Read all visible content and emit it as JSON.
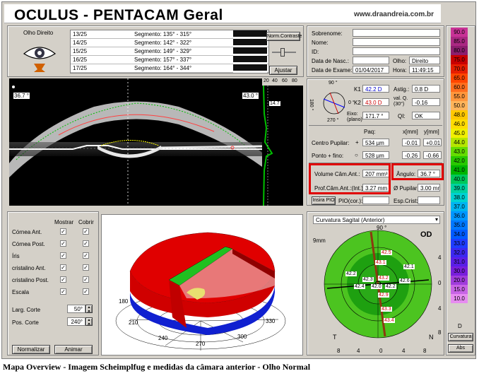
{
  "header": {
    "title": "OCULUS  -  PENTACAM   Geral",
    "site": "www.draandreia.com.br"
  },
  "eye_panel": {
    "label": "Olho Direito"
  },
  "segments": [
    {
      "index": "13/25",
      "text": "Segmento: 135° - 315°"
    },
    {
      "index": "14/25",
      "text": "Segmento: 142° - 322°"
    },
    {
      "index": "15/25",
      "text": "Segmento: 149° - 329°"
    },
    {
      "index": "16/25",
      "text": "Segmento: 157° - 337°"
    },
    {
      "index": "17/25",
      "text": "Segmento: 164° - 344°"
    }
  ],
  "buttons": {
    "norm_contrast": "Norm.Contraste",
    "adjust": "Ajustar",
    "normalize": "Normalizar",
    "animate": "Animar",
    "insira_pio": "Insira PIO",
    "curvatura": "Curvatura",
    "abs": "Abs"
  },
  "scheimpflug": {
    "left_angle": "36.7 °",
    "right_angle": "43.0 °",
    "histo_labels": [
      "20",
      "40",
      "60",
      "80"
    ],
    "histo_value": "14.7"
  },
  "patient": {
    "labels": {
      "surname": "Sobrenome:",
      "name": "Nome:",
      "id": "ID:",
      "birth": "Data de Nasc.:",
      "eye": "Olho:",
      "exam_date": "Data de Exame:",
      "time": "Hora:"
    },
    "surname": "",
    "name": "",
    "id": "",
    "birth": "",
    "eye": "Direito",
    "exam_date": "01/04/2017",
    "time": "11:49:15"
  },
  "keratometry": {
    "k1_label": "K1",
    "k1": "42.2 D",
    "k2_label": "K2",
    "k2": "43.0 D",
    "astig_label": "Astig.:",
    "astig": "0.8 D",
    "q_label": "val. Q.\n(30°)",
    "q": "-0.16",
    "axis_label": "Eixo:\n(plano)",
    "axis": "171.7 °",
    "qi_label": "QI:",
    "qi": "OK",
    "compass": {
      "top": "90 °",
      "left": "180 °",
      "bottom": "270 °",
      "right": "0 °"
    }
  },
  "pupil": {
    "hdr_paq": "Paq:",
    "hdr_x": "x[mm]",
    "hdr_y": "y[mm]",
    "centro_label": "Centro Pupilar:",
    "centro_sym": "+",
    "centro_paq": "534 µm",
    "centro_x": "-0.01",
    "centro_y": "+0.01",
    "ponto_label": "Ponto + fino:",
    "ponto_sym": "○",
    "ponto_paq": "528 µm",
    "ponto_x": "-0.26",
    "ponto_y": "-0.66"
  },
  "chamber": {
    "vol_label": "Volume Câm.Ant.:",
    "vol": "207 mm³",
    "angle_label": "Ângulo:",
    "angle": "36.7 °",
    "depth_label": "Prof.Câm.Ant.:(Int.)",
    "depth": "3.27 mm",
    "pupil_label": "Ø Pupilar:",
    "pupil": "3.00 mm",
    "pio_cor": "PIO(cor.):",
    "esp_crist": "Esp.Crist:"
  },
  "layers": {
    "hdr_show": "Mostrar",
    "hdr_cut": "Cobrir",
    "rows": [
      "Córnea Ant.",
      "Córnea Post.",
      "Íris",
      "cristalino Ant.",
      "cristalino Post.",
      "Escala"
    ],
    "cut_width_label": "Larg. Corte",
    "cut_width": "50°",
    "cut_pos_label": "Pos. Corte",
    "cut_pos": "240°"
  },
  "view3d": {
    "a180": "180",
    "a210": "210",
    "a240": "240",
    "a270": "270",
    "a300": "300",
    "a330": "330"
  },
  "map": {
    "dropdown": "Curvatura Sagital (Anterior)",
    "od": "OD",
    "mm": "9mm",
    "top90": "90 °",
    "t": "T",
    "n": "N",
    "ticks": [
      "8",
      "4",
      "0",
      "4",
      "8"
    ],
    "rticks": [
      "4",
      "0",
      "4",
      "8"
    ],
    "values": [
      "42.5",
      "43.1",
      "42.1",
      "42.2",
      "42.4",
      "42.0",
      "42.2",
      "42.6",
      "42.9",
      "42.3",
      "43.3",
      "43.4",
      "43.2"
    ]
  },
  "color_scale": [
    "90.0",
    "85.0",
    "80.0",
    "75.0",
    "70.0",
    "65.0",
    "60.0",
    "55.0",
    "50.0",
    "48.0",
    "46.0",
    "45.0",
    "44.0",
    "43.0",
    "42.0",
    "41.0",
    "40.0",
    "39.0",
    "38.0",
    "37.0",
    "36.0",
    "35.0",
    "34.0",
    "33.0",
    "32.0",
    "31.0",
    "30.0",
    "20.0",
    "15.0",
    "10.0"
  ],
  "color_scale_colors": [
    "#c83296",
    "#aa2882",
    "#8c1e6e",
    "#c80000",
    "#e61e00",
    "#ff4600",
    "#ff6e1e",
    "#ff963c",
    "#ffb45a",
    "#ffc800",
    "#ffdc00",
    "#f0f000",
    "#b4e600",
    "#64dc00",
    "#28c800",
    "#00b400",
    "#00c85a",
    "#00d2a0",
    "#00d2d2",
    "#00b4f0",
    "#0096ff",
    "#0078ff",
    "#005aff",
    "#1e3cff",
    "#3c28f0",
    "#5a1ee6",
    "#781edc",
    "#a03cdc",
    "#c864e6",
    "#e68cf0"
  ],
  "scale_footer": "D",
  "caption": "Mapa Overview - Imagem Scheimplfug e medidas da câmara anterior - Olho Normal"
}
